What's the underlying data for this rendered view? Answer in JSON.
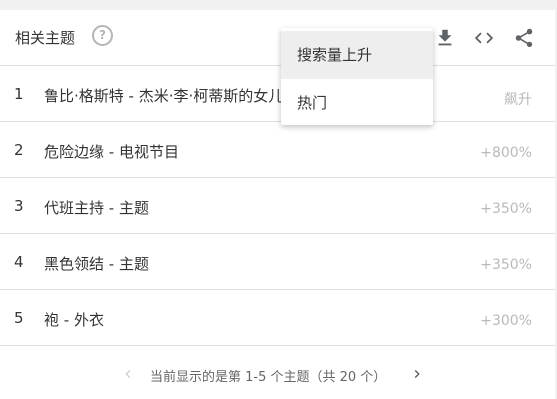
{
  "header": {
    "title": "相关主题",
    "help_icon": "help-circle-icon",
    "icons": [
      "download-icon",
      "embed-code-icon",
      "share-icon"
    ]
  },
  "rows": [
    {
      "rank": "1",
      "name": "鲁比·格斯特 - 杰米·李·柯蒂斯的女儿",
      "value": "飙升"
    },
    {
      "rank": "2",
      "name": "危险边缘 - 电视节目",
      "value": "+800%"
    },
    {
      "rank": "3",
      "name": "代班主持 - 主题",
      "value": "+350%"
    },
    {
      "rank": "4",
      "name": "黑色领结 - 主题",
      "value": "+350%"
    },
    {
      "rank": "5",
      "name": "袍 - 外衣",
      "value": "+300%"
    }
  ],
  "pager": {
    "text": "当前显示的是第 1-5 个主题（共 20 个）",
    "prev_icon": "chevron-left-icon",
    "next_icon": "chevron-right-icon"
  },
  "dropdown": {
    "options": [
      "搜索量上升",
      "热门"
    ],
    "selected": "搜索量上升"
  },
  "colors": {
    "value_text": "#b9b9b9",
    "icon_gray": "#5f6368",
    "divider": "#e0e0e0"
  }
}
